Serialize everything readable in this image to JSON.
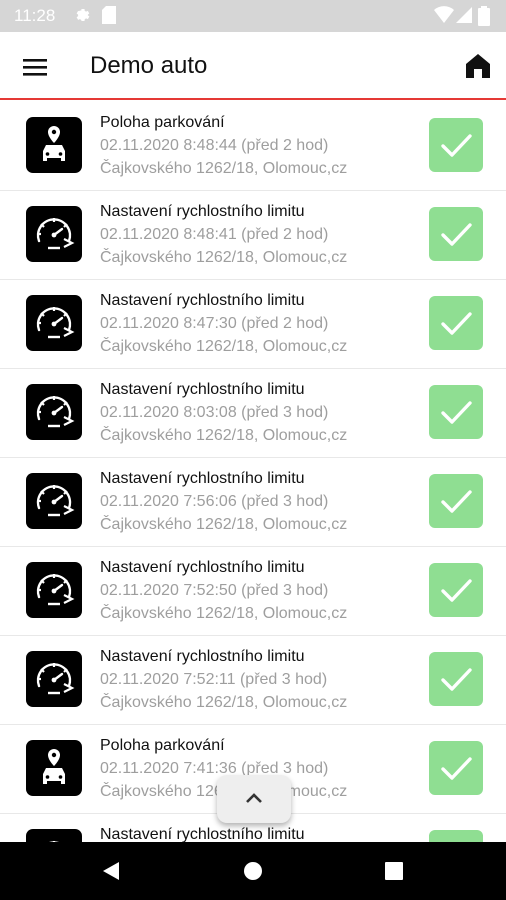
{
  "status_bar": {
    "time": "11:28",
    "icons": [
      "gear-icon",
      "sim-icon",
      "wifi-icon",
      "signal-icon",
      "battery-icon"
    ]
  },
  "app_bar": {
    "title": "Demo auto",
    "menu_icon": "hamburger-menu-icon",
    "home_icon": "home-icon",
    "accent_color": "#e53935"
  },
  "events": [
    {
      "type": "parking",
      "icon": "parking-location-icon",
      "title": "Poloha parkování",
      "date": "02.11.2020 8:48:44 (před 2 hod)",
      "address": "Čajkovského 1262/18, Olomouc,cz",
      "status": "confirmed"
    },
    {
      "type": "speed",
      "icon": "speedometer-icon",
      "title": "Nastavení rychlostního limitu",
      "date": "02.11.2020 8:48:41 (před 2 hod)",
      "address": "Čajkovského 1262/18, Olomouc,cz",
      "status": "confirmed"
    },
    {
      "type": "speed",
      "icon": "speedometer-icon",
      "title": "Nastavení rychlostního limitu",
      "date": "02.11.2020 8:47:30 (před 2 hod)",
      "address": "Čajkovského 1262/18, Olomouc,cz",
      "status": "confirmed"
    },
    {
      "type": "speed",
      "icon": "speedometer-icon",
      "title": "Nastavení rychlostního limitu",
      "date": "02.11.2020 8:03:08 (před 3 hod)",
      "address": "Čajkovského 1262/18, Olomouc,cz",
      "status": "confirmed"
    },
    {
      "type": "speed",
      "icon": "speedometer-icon",
      "title": "Nastavení rychlostního limitu",
      "date": "02.11.2020 7:56:06 (před 3 hod)",
      "address": "Čajkovského 1262/18, Olomouc,cz",
      "status": "confirmed"
    },
    {
      "type": "speed",
      "icon": "speedometer-icon",
      "title": "Nastavení rychlostního limitu",
      "date": "02.11.2020 7:52:50 (před 3 hod)",
      "address": "Čajkovského 1262/18, Olomouc,cz",
      "status": "confirmed"
    },
    {
      "type": "speed",
      "icon": "speedometer-icon",
      "title": "Nastavení rychlostního limitu",
      "date": "02.11.2020 7:52:11 (před 3 hod)",
      "address": "Čajkovského 1262/18, Olomouc,cz",
      "status": "confirmed"
    },
    {
      "type": "parking",
      "icon": "parking-location-icon",
      "title": "Poloha parkování",
      "date": "02.11.2020 7:41:36 (před 3 hod)",
      "address": "Čajkovského 1262/18, Olomouc,cz",
      "status": "confirmed"
    },
    {
      "type": "speed",
      "icon": "speedometer-icon",
      "title": "Nastavení rychlostního limitu",
      "date": "",
      "address": "",
      "status": "confirmed"
    }
  ],
  "scroll_up_button": {
    "icon": "chevron-up-icon"
  },
  "nav_bar": {
    "icons": [
      "back-icon",
      "home-circle-icon",
      "recents-icon"
    ]
  },
  "colors": {
    "check_bg": "#8fde92",
    "secondary_text": "#9e9e9e"
  }
}
